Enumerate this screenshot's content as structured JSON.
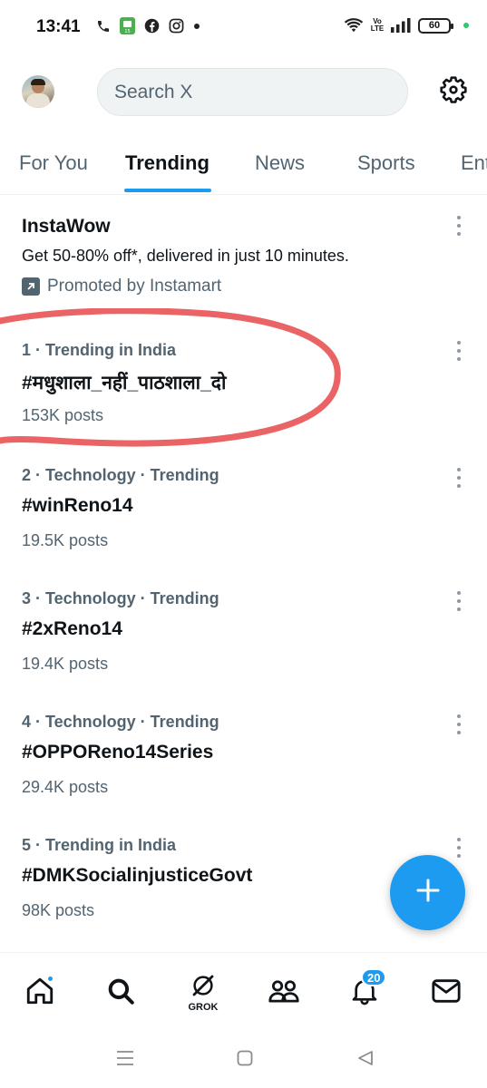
{
  "status_bar": {
    "time": "13:41",
    "battery": "60",
    "network": "Vo LTE",
    "icons": [
      "phone-icon",
      "app-icon",
      "facebook-icon",
      "instagram-icon",
      "dot-icon",
      "wifi-icon",
      "signal-icon",
      "battery-icon"
    ]
  },
  "header": {
    "search_placeholder": "Search X",
    "settings_icon": "gear-icon"
  },
  "tabs": [
    {
      "label": "For You",
      "active": false
    },
    {
      "label": "Trending",
      "active": true
    },
    {
      "label": "News",
      "active": false
    },
    {
      "label": "Sports",
      "active": false
    },
    {
      "label": "Ent",
      "active": false
    }
  ],
  "promoted": {
    "title": "InstaWow",
    "description": "Get 50-80% off*, delivered in just 10 minutes.",
    "promoted_by": "Promoted by Instamart"
  },
  "trends": [
    {
      "context": "1 · Trending in India",
      "name": "#मधुशाला_नहीं_पाठशाला_दो",
      "count": "153K posts"
    },
    {
      "context": "2 · Technology · Trending",
      "name": "#winReno14",
      "count": "19.5K posts"
    },
    {
      "context": "3 · Technology · Trending",
      "name": "#2xReno14",
      "count": "19.4K posts"
    },
    {
      "context": "4 · Technology · Trending",
      "name": "#OPPOReno14Series",
      "count": "29.4K posts"
    },
    {
      "context": "5 · Trending in India",
      "name": "#DMKSocialinjusticeGovt",
      "count": "98K posts"
    }
  ],
  "bottom_nav": {
    "items": [
      "home-icon",
      "search-icon",
      "grok-icon",
      "communities-icon",
      "notifications-icon",
      "messages-icon"
    ],
    "grok_label": "GROK",
    "notifications_badge": "20"
  },
  "colors": {
    "accent": "#1d9bf0",
    "secondary_text": "#536471",
    "annotation": "#e8494a"
  }
}
